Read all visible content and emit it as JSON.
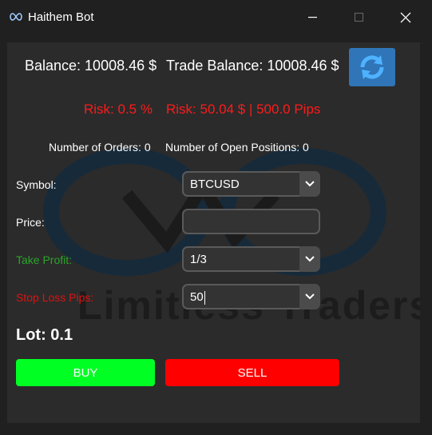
{
  "window": {
    "title": "Haithem Bot",
    "icons": {
      "app": "infinity-icon",
      "minimize": "minimize-icon",
      "maximize": "maximize-icon",
      "close": "close-icon"
    }
  },
  "account": {
    "balance": "Balance: 10008.46 $",
    "trade_balance": "Trade Balance: 10008.46 $",
    "refresh_icon": "refresh-icon"
  },
  "risk": {
    "percent": "Risk: 0.5 %",
    "amount": "Risk: 50.04 $ | 500.0 Pips",
    "color": "#ff1a1a"
  },
  "counts": {
    "orders": "Number of Orders: 0",
    "positions": "Number of Open Positions: 0"
  },
  "form": {
    "symbol": {
      "label": "Symbol:",
      "value": "BTCUSD"
    },
    "price": {
      "label": "Price:",
      "value": ""
    },
    "take_profit": {
      "label": "Take Profit:",
      "value": "1/3",
      "color": "#2aa52a"
    },
    "stop_loss": {
      "label": "Stop Loss Pips:",
      "value": "50",
      "color": "#e01010"
    }
  },
  "lot": "Lot: 0.1",
  "actions": {
    "buy": {
      "label": "BUY",
      "color": "#00ff22"
    },
    "sell": {
      "label": "SELL",
      "color": "#ff0000"
    }
  },
  "watermark": {
    "text": "Limitless Traders"
  }
}
